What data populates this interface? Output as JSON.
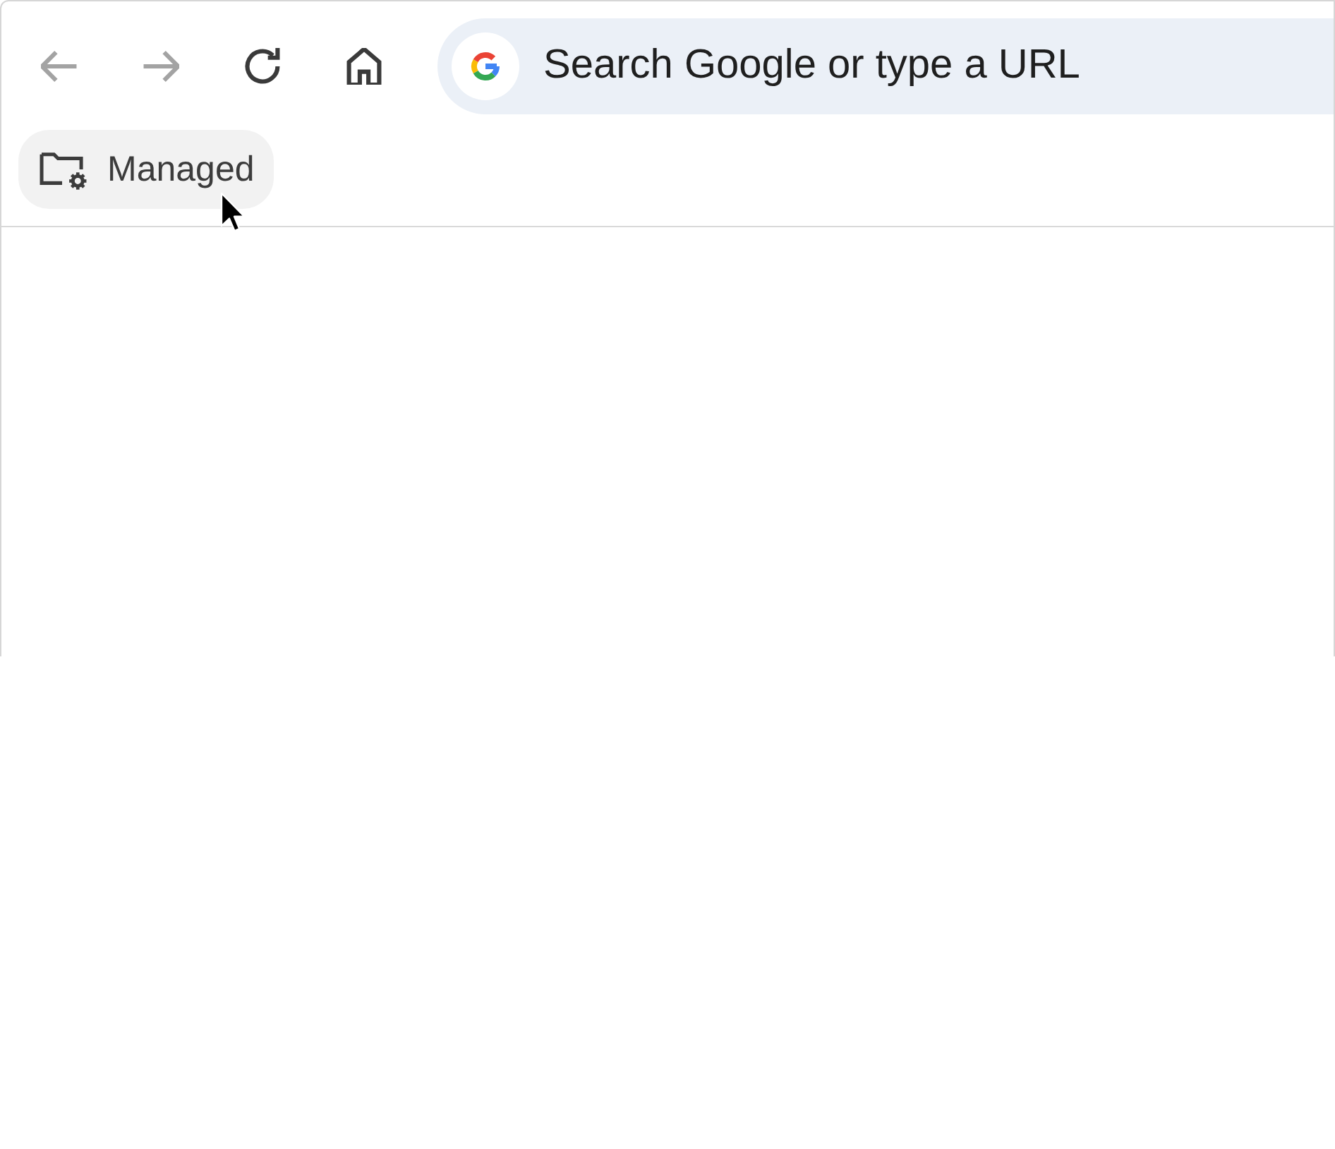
{
  "toolbar": {
    "buttons": [
      {
        "kind": "back",
        "disabled": true
      },
      {
        "kind": "forward",
        "disabled": true
      },
      {
        "kind": "reload",
        "disabled": false
      },
      {
        "kind": "home",
        "disabled": false
      }
    ],
    "omnibox": {
      "placeholder": "Search Google or type a URL"
    }
  },
  "bookmarks_bar": {
    "items": [
      {
        "kind": "managed-folder",
        "label": "Managed",
        "hovered": true
      }
    ]
  }
}
